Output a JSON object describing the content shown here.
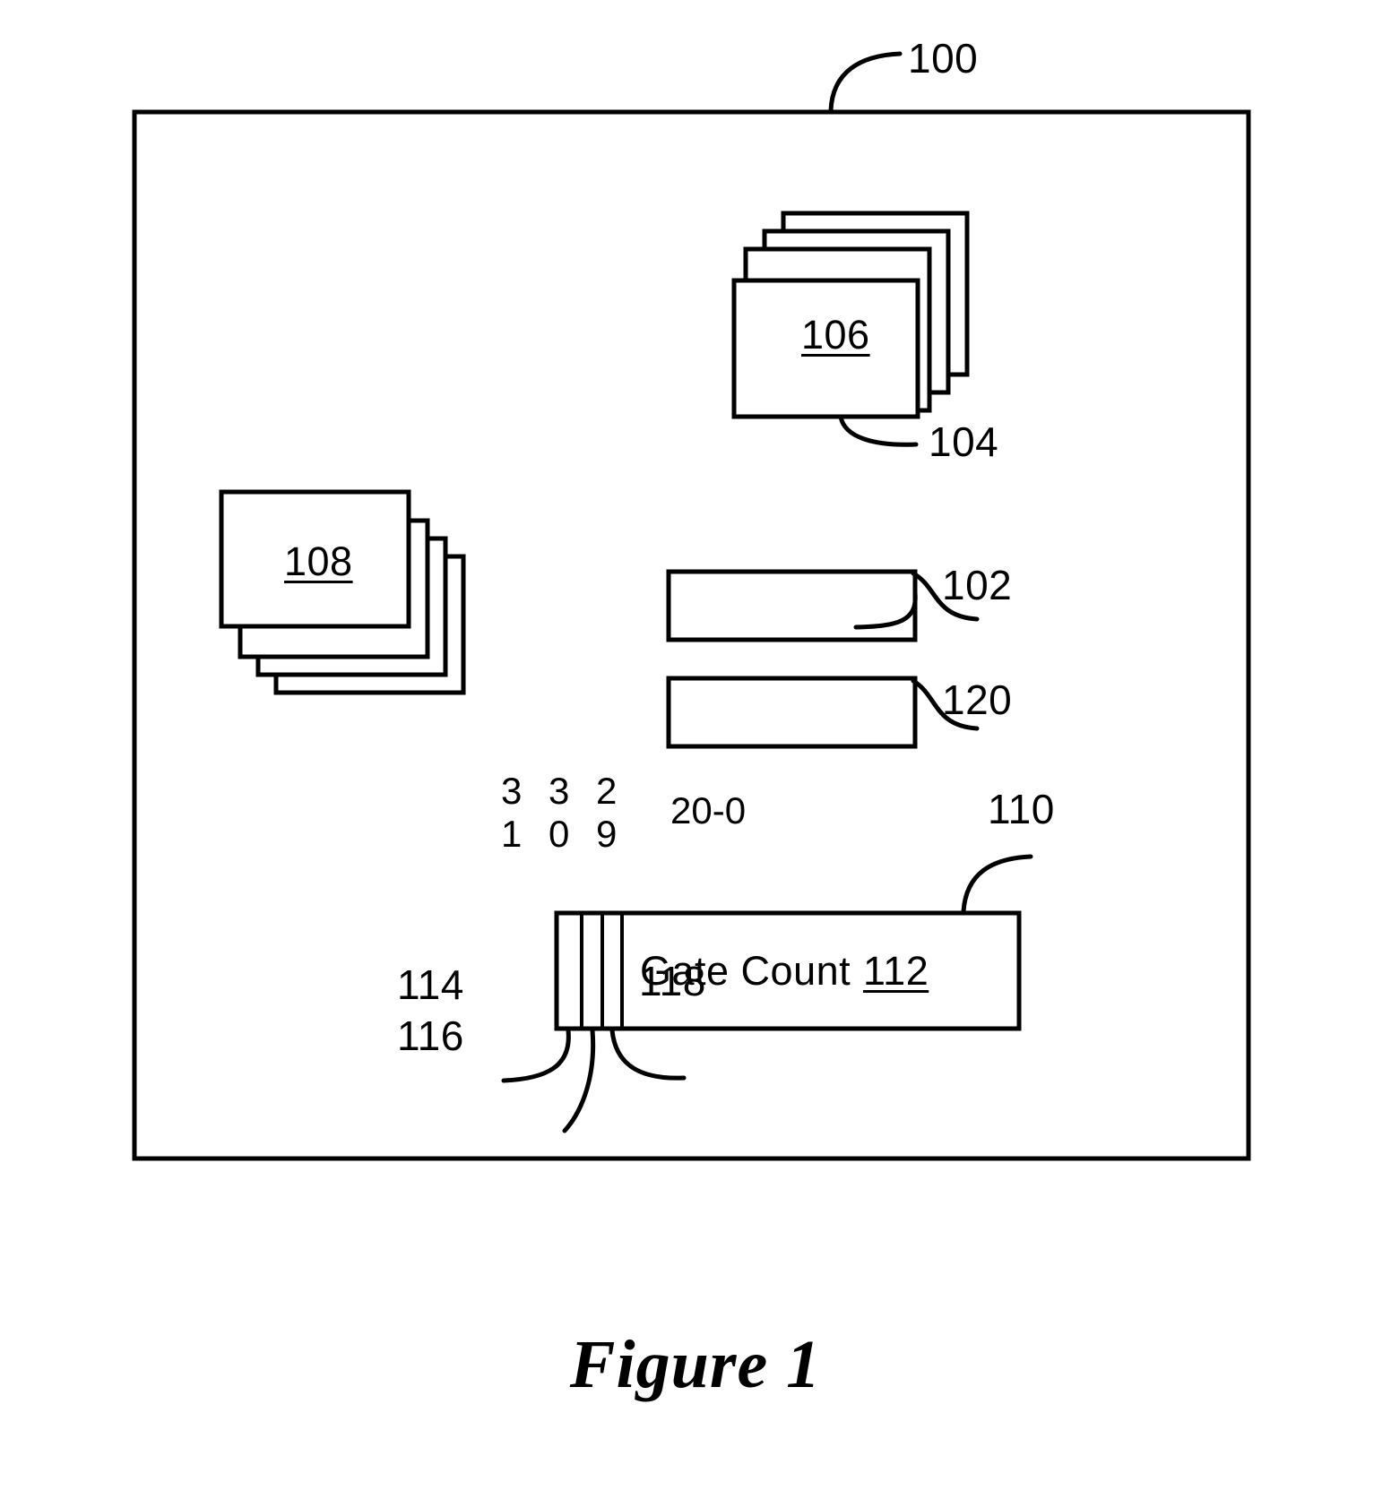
{
  "figure": {
    "caption": "Figure 1",
    "outer_frame_ref": "100"
  },
  "refs": {
    "frame": "100",
    "page_stack_top": "104",
    "page_stack_top_label": "106",
    "page_stack_left_label": "108",
    "bar_upper": "102",
    "bar_lower": "120",
    "register": "110",
    "register_field_label": "112",
    "bit_field_1": "114",
    "bit_field_2": "116",
    "bit_field_3": "118"
  },
  "register": {
    "field_name": "Gate Count",
    "field_ref": "112",
    "bit_range": "20-0",
    "bit_numbers_top": "3 3 2",
    "bit_numbers_bottom": "1 0 9"
  },
  "stacks": {
    "top_right": {
      "label": "106",
      "ref": "104",
      "sheets": 4
    },
    "left": {
      "label": "108",
      "sheets": 4
    }
  },
  "bars": [
    {
      "ref": "102"
    },
    {
      "ref": "120"
    }
  ],
  "colors": {
    "ink": "#000000",
    "paper": "#ffffff"
  }
}
